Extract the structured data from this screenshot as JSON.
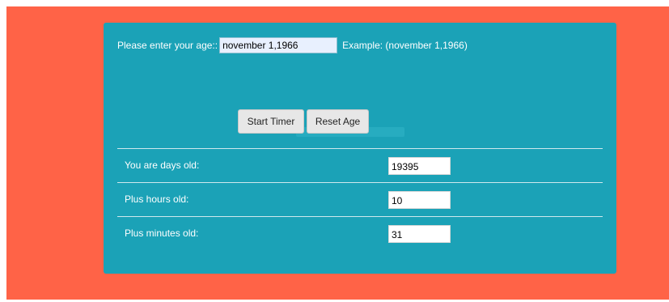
{
  "age_form": {
    "prompt_label": "Please enter your age::",
    "age_value": "november 1,1966",
    "example_text": "Example: (november 1,1966)"
  },
  "buttons": {
    "start_label": "Start Timer",
    "reset_label": "Reset Age"
  },
  "results": {
    "days_label": "You are days old:",
    "days_value": "19395",
    "hours_label": "Plus hours old:",
    "hours_value": "10",
    "minutes_label": "Plus minutes old:",
    "minutes_value": "31"
  },
  "colors": {
    "page_background": "#ff6347",
    "panel_background": "#1ba2b7",
    "button_background": "#e7e7e7"
  }
}
